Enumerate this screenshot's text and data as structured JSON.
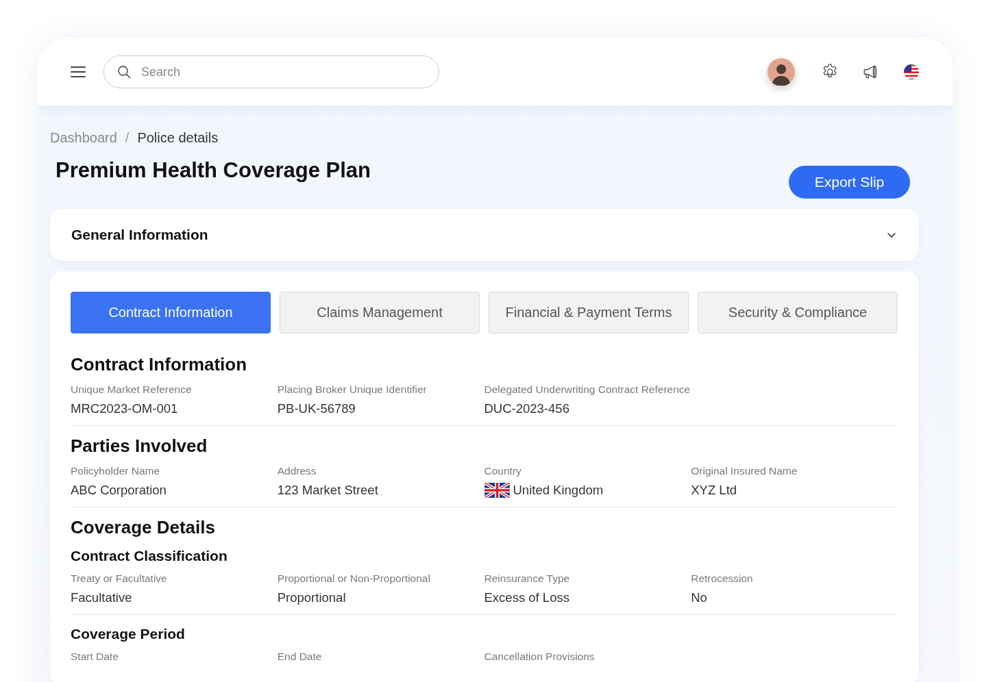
{
  "search": {
    "placeholder": "Search"
  },
  "breadcrumb_separator": "/",
  "breadcrumb": [
    {
      "label": "Dashboard",
      "current": false
    },
    {
      "label": "Police details",
      "current": true
    }
  ],
  "title": "Premium Health Coverage Plan",
  "export_button": "Export Slip",
  "general_info": {
    "title": "General Information",
    "expanded": false
  },
  "tabs": [
    {
      "label": "Contract Information",
      "selected": true
    },
    {
      "label": "Claims Management",
      "selected": false
    },
    {
      "label": "Financial & Payment Terms",
      "selected": false
    },
    {
      "label": "Security & Compliance",
      "selected": false
    }
  ],
  "sections": [
    {
      "kind": "section",
      "title": "Contract Information",
      "fields": [
        {
          "label": "Unique Market Reference",
          "value": "MRC2023-OM-001"
        },
        {
          "label": "Placing Broker Unique Identifier",
          "value": "PB-UK-56789"
        },
        {
          "label": "Delegated Underwriting Contract Reference",
          "value": "DUC-2023-456"
        }
      ]
    },
    {
      "kind": "section",
      "title": "Parties Involved",
      "fields": [
        {
          "kind": "text",
          "label": "Policyholder Name",
          "value": "ABC Corporation"
        },
        {
          "kind": "text",
          "label": "Address",
          "value": "123 Market Street"
        },
        {
          "kind": "country",
          "label": "Country",
          "value": "United Kingdom"
        },
        {
          "kind": "text",
          "label": "Original Insured Name",
          "value": "XYZ Ltd"
        }
      ]
    },
    {
      "kind": "section",
      "title": "Coverage Details"
    },
    {
      "kind": "subsection",
      "title": "Contract Classification",
      "fields": [
        {
          "label": "Treaty or Facultative",
          "value": "Facultative"
        },
        {
          "label": "Proportional or Non-Proportional",
          "value": "Proportional"
        },
        {
          "label": "Reinsurance Type",
          "value": "Excess of Loss"
        },
        {
          "label": "Retrocession",
          "value": "No"
        }
      ]
    },
    {
      "kind": "subsection",
      "title": "Coverage Period",
      "fields": [
        {
          "label": "Start Date"
        },
        {
          "label": "End Date"
        },
        {
          "label": "Cancellation Provisions"
        }
      ]
    }
  ]
}
